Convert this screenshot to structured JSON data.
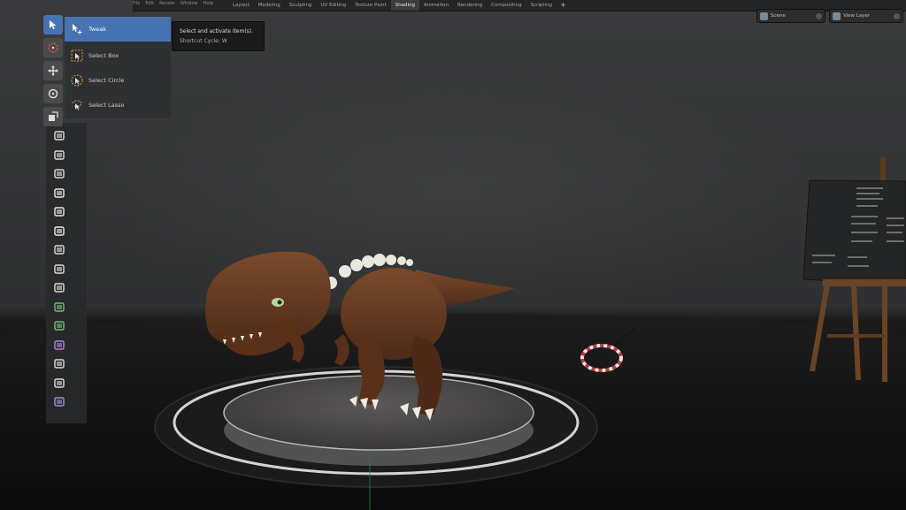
{
  "header": {
    "menu_fragments": [
      "File",
      "Edit",
      "Render",
      "Window",
      "Help"
    ],
    "workspace_tabs": [
      {
        "label": "Layout"
      },
      {
        "label": "Modeling"
      },
      {
        "label": "Sculpting"
      },
      {
        "label": "UV Editing"
      },
      {
        "label": "Texture Paint"
      },
      {
        "label": "Shading",
        "active": true
      },
      {
        "label": "Animation"
      },
      {
        "label": "Rendering"
      },
      {
        "label": "Compositing"
      },
      {
        "label": "Scripting"
      }
    ],
    "add_workspace": "+",
    "scene_field": {
      "label": "Scene"
    },
    "view_layer_field": {
      "label": "View Layer"
    }
  },
  "toolbar": {
    "active_tool": "select-tweak",
    "icons": [
      "cursor-icon",
      "move-icon",
      "rotate-icon",
      "scale-icon",
      "transform-icon",
      "annotate-icon",
      "measure-icon",
      "add-cube-icon",
      "extrude-icon",
      "inset-icon",
      "bevel-icon",
      "loop-cut-icon",
      "knife-icon",
      "poly-build-icon",
      "spin-icon",
      "smooth-icon",
      "shrink-fatten-icon",
      "shear-icon",
      "rip-icon"
    ],
    "select_flyout": [
      {
        "label": "Tweak",
        "active": true,
        "icon": "tweak-icon"
      },
      {
        "label": "Select Box",
        "icon": "select-box-icon"
      },
      {
        "label": "Select Circle",
        "icon": "select-circle-icon"
      },
      {
        "label": "Select Lasso",
        "icon": "select-lasso-icon"
      }
    ],
    "tooltip": {
      "title": "Select and activate item(s).",
      "shortcut": "Shortcut Cycle: W"
    }
  },
  "viewport": {
    "subject": "dinosaur-model",
    "props": [
      "turntable-platform",
      "easel-with-board",
      "striped-ring-object"
    ],
    "accent_color": "#4772b3",
    "dino_color": "#6b3d22"
  }
}
